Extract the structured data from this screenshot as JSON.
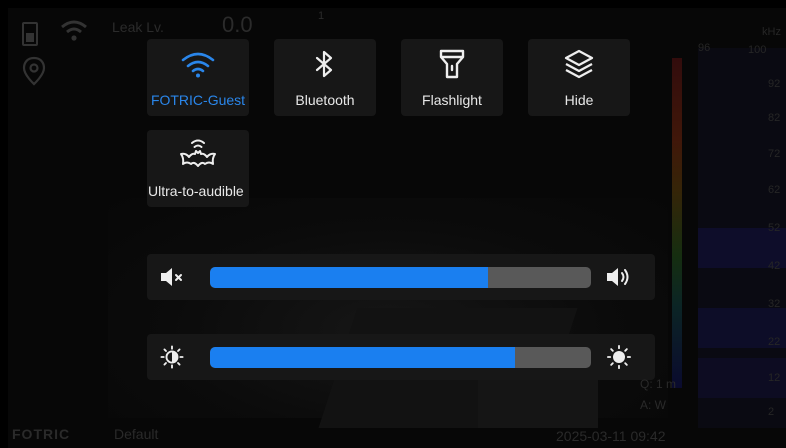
{
  "status_bar": {
    "battery_icon": "battery-icon",
    "wifi_icon": "wifi-icon",
    "location_icon": "location-pin-icon",
    "label": "Leak Lv.",
    "value": "0.0",
    "marker": "1"
  },
  "quick_tiles": [
    {
      "label": "FOTRIC-Guest",
      "icon": "wifi-icon",
      "active": true
    },
    {
      "label": "Bluetooth",
      "icon": "bluetooth-icon",
      "active": false
    },
    {
      "label": "Flashlight",
      "icon": "flashlight-icon",
      "active": false
    },
    {
      "label": "Hide",
      "icon": "layers-icon",
      "active": false
    },
    {
      "label": "Ultra-to-audible",
      "icon": "ultrasound-bat-icon",
      "active": false
    }
  ],
  "volume": {
    "left_icon": "volume-mute-icon",
    "right_icon": "volume-up-icon",
    "level_percent": 73
  },
  "brightness": {
    "left_icon": "brightness-low-icon",
    "right_icon": "brightness-high-icon",
    "level_percent": 80
  },
  "spectrum": {
    "unit": "kHz",
    "top_scale": "100",
    "left_value": "96",
    "ticks": [
      "92",
      "82",
      "72",
      "62",
      "52",
      "42",
      "32",
      "22",
      "12",
      "2"
    ]
  },
  "bottom_bar": {
    "brand": "FOTRIC",
    "mode": "Default",
    "datetime": "2025-03-11 09:42",
    "readout_a": "Q: 1 m",
    "readout_b": "A: W"
  },
  "colors": {
    "accent": "#1a7ff0",
    "tile_bg": "#171717",
    "track": "#595959"
  }
}
